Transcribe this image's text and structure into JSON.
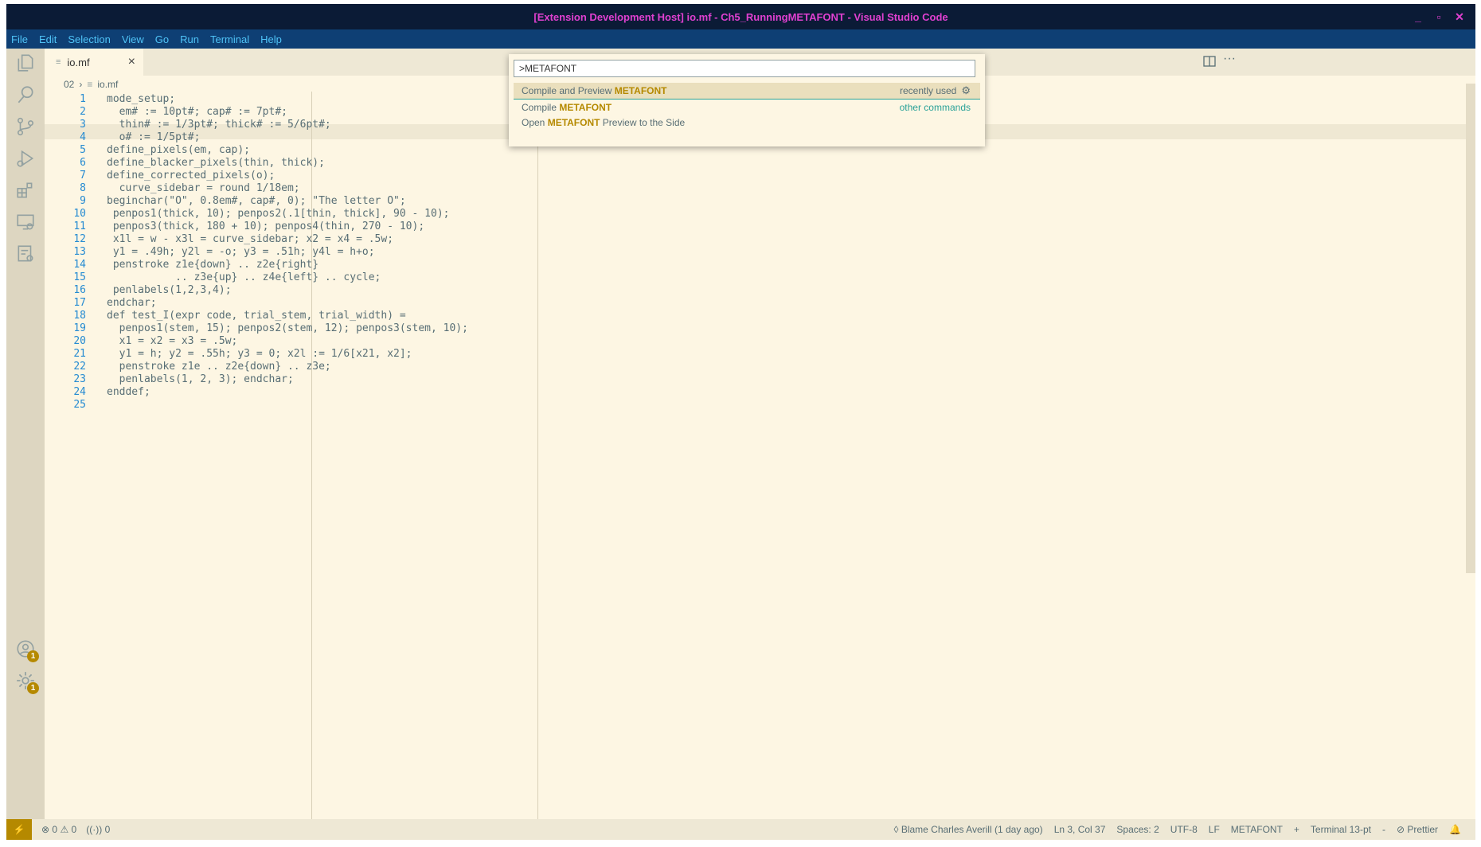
{
  "window": {
    "title": "[Extension Development Host] io.mf - Ch5_RunningMETAFONT - Visual Studio Code",
    "controls": {
      "minimize": "_",
      "maximize": "▫",
      "close": "✕"
    }
  },
  "menu": [
    "File",
    "Edit",
    "Selection",
    "View",
    "Go",
    "Run",
    "Terminal",
    "Help"
  ],
  "tab": {
    "filename": "io.mf",
    "close": "×"
  },
  "breadcrumb": {
    "folder": "02",
    "file": "io.mf"
  },
  "quick_open": {
    "input_value": ">METAFONT",
    "items": [
      {
        "prefix": "Compile and Preview ",
        "highlight": "METAFONT",
        "suffix": "",
        "description": "recently used"
      },
      {
        "prefix": "Compile ",
        "highlight": "METAFONT",
        "suffix": "",
        "description": "other commands"
      },
      {
        "prefix": "Open ",
        "highlight": "METAFONT",
        "suffix": " Preview to the Side",
        "description": ""
      }
    ]
  },
  "editor": {
    "lines": [
      "mode_setup;",
      "  em# := 10pt#; cap# := 7pt#;",
      "  thin# := 1/3pt#; thick# := 5/6pt#;",
      "  o# := 1/5pt#;",
      "define_pixels(em, cap);",
      "define_blacker_pixels(thin, thick);",
      "define_corrected_pixels(o);",
      "  curve_sidebar = round 1/18em;",
      "beginchar(\"O\", 0.8em#, cap#, 0); \"The letter O\";",
      " penpos1(thick, 10); penpos2(.1[thin, thick], 90 - 10);",
      " penpos3(thick, 180 + 10); penpos4(thin, 270 - 10);",
      " x1l = w - x3l = curve_sidebar; x2 = x4 = .5w;",
      " y1 = .49h; y2l = -o; y3 = .51h; y4l = h+o;",
      " penstroke z1e{down} .. z2e{right}",
      "           .. z3e{up} .. z4e{left} .. cycle;",
      " penlabels(1,2,3,4);",
      "endchar;",
      "def test_I(expr code, trial_stem, trial_width) =",
      "  penpos1(stem, 15); penpos2(stem, 12); penpos3(stem, 10);",
      "  x1 = x2 = x3 = .5w;",
      "  y1 = h; y2 = .55h; y3 = 0; x2l := 1/6[x21, x2];",
      "  penstroke z1e .. z2e{down} .. z3e;",
      "  penlabels(1, 2, 3); endchar;",
      "enddef;",
      ""
    ]
  },
  "status": {
    "errors": "0",
    "warnings": "0",
    "ports": "0",
    "blame": "Blame Charles Averill (1 day ago)",
    "position": "Ln 3, Col 37",
    "spaces": "Spaces: 2",
    "encoding": "UTF-8",
    "eol": "LF",
    "language": "METAFONT",
    "plus": "+",
    "terminal": "Terminal 13-pt",
    "dash": "-",
    "prettier": "Prettier"
  },
  "badges": {
    "accounts": "1",
    "manage": "1"
  }
}
